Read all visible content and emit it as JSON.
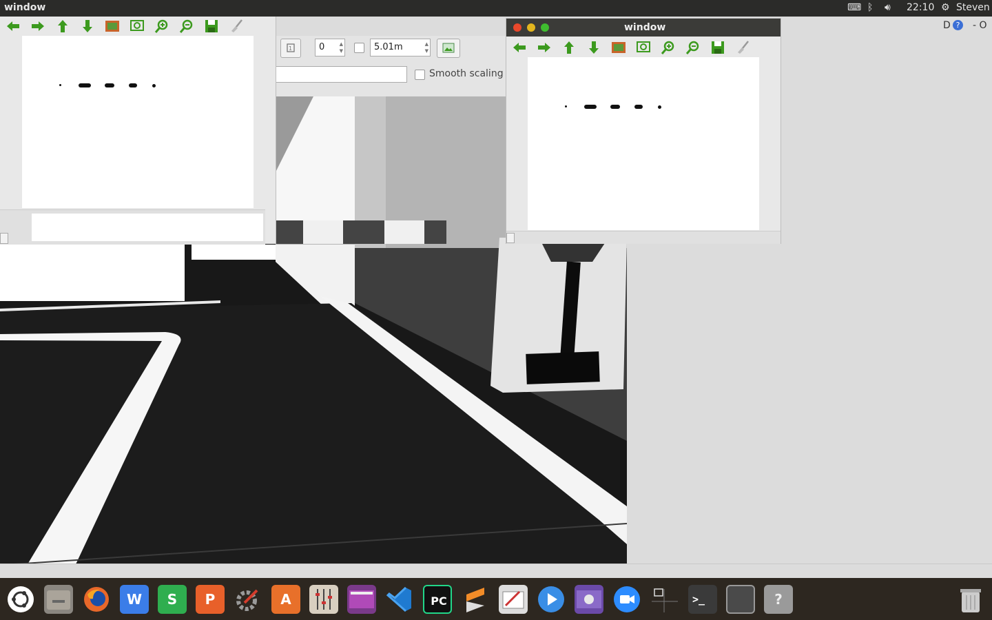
{
  "topbar": {
    "window_title": "window",
    "time": "22:10",
    "user": "Steven"
  },
  "rviz_panel": {
    "spin_value": "0",
    "distance_value": "5.01m",
    "smooth_scaling_label": "Smooth scaling"
  },
  "right_window": {
    "title": "window"
  },
  "side_fragment": "D",
  "side_fragment2": "- O",
  "dock_items": [
    "ubuntu",
    "files",
    "firefox",
    "wps-writer",
    "wps-spreadsheets",
    "wps-presentation",
    "system-settings",
    "software-center",
    "mixer",
    "video",
    "vscode",
    "pycharm",
    "sublime",
    "screenshot-editor",
    "media-player",
    "video-editor",
    "zoom",
    "window-switcher",
    "terminal",
    "blank-window",
    "unknown-app",
    "trash"
  ],
  "colors": {
    "toolbar_green": "#3c9a1e",
    "dock_bg": "#2d2720",
    "topbar_bg": "#2b2b29"
  }
}
